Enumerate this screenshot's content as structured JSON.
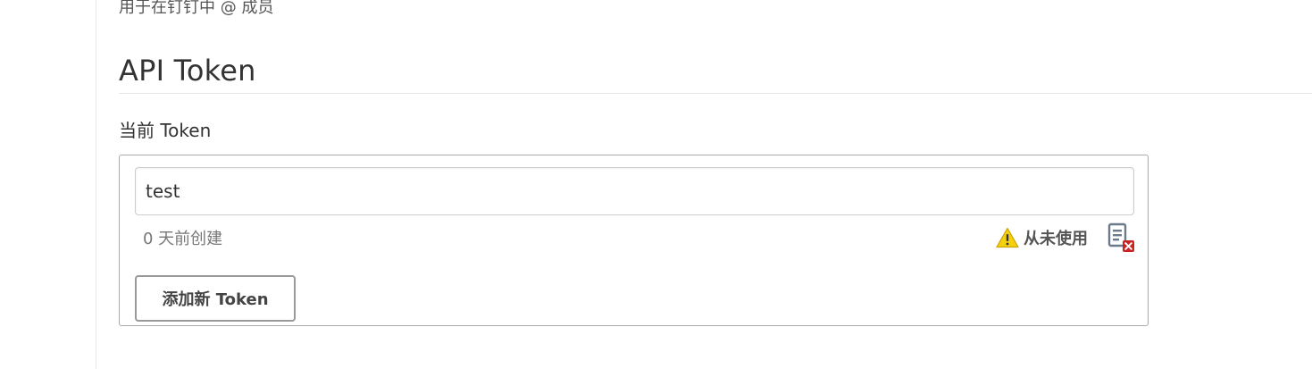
{
  "profile": {
    "dingtalk_hint": "用于在钉钉中 @ 成员"
  },
  "api_token": {
    "section_title": "API Token",
    "current_label": "当前 Token",
    "token": {
      "value": "test",
      "created": "0 天前创建",
      "usage_status": "从未使用",
      "status_icon": "warning-icon",
      "delete_icon": "delete-icon",
      "status_color": "#e6c200",
      "delete_color": "#cc2222"
    },
    "add_button_label": "添加新 Token"
  }
}
